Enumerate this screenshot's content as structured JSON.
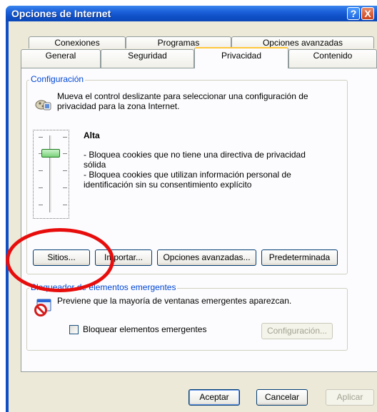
{
  "window": {
    "title": "Opciones de Internet",
    "help_label": "?",
    "close_label": "X"
  },
  "tabs": {
    "row1": [
      "Conexiones",
      "Programas",
      "Opciones avanzadas"
    ],
    "row2": [
      "General",
      "Seguridad",
      "Privacidad",
      "Contenido"
    ],
    "active": "Privacidad"
  },
  "config": {
    "legend": "Configuración",
    "description": "Mueva el control deslizante para seleccionar una configuración de privacidad para la zona Internet.",
    "level": "Alta",
    "level_detail_1": "- Bloquea cookies que no tiene una directiva de privacidad sólida",
    "level_detail_2": "- Bloquea cookies que utilizan información personal de identificación sin su consentimiento explícito",
    "slider_position": "Alta",
    "buttons": {
      "sites": "Sitios...",
      "import": "Importar...",
      "advanced": "Opciones avanzadas...",
      "default": "Predeterminada"
    }
  },
  "popup": {
    "legend": "Bloqueador de elementos emergentes",
    "description": "Previene que la mayoría de ventanas emergentes aparezcan.",
    "checkbox_label": "Bloquear elementos emergentes",
    "checkbox_checked": false,
    "settings_button": "Configuración..."
  },
  "footer": {
    "accept": "Aceptar",
    "cancel": "Cancelar",
    "apply": "Aplicar"
  },
  "colors": {
    "titlebar": "#0f4fc6",
    "dialog_bg": "#ece9d8",
    "legend_text": "#0046d5",
    "annotation_ellipse": "#e80d0d"
  }
}
